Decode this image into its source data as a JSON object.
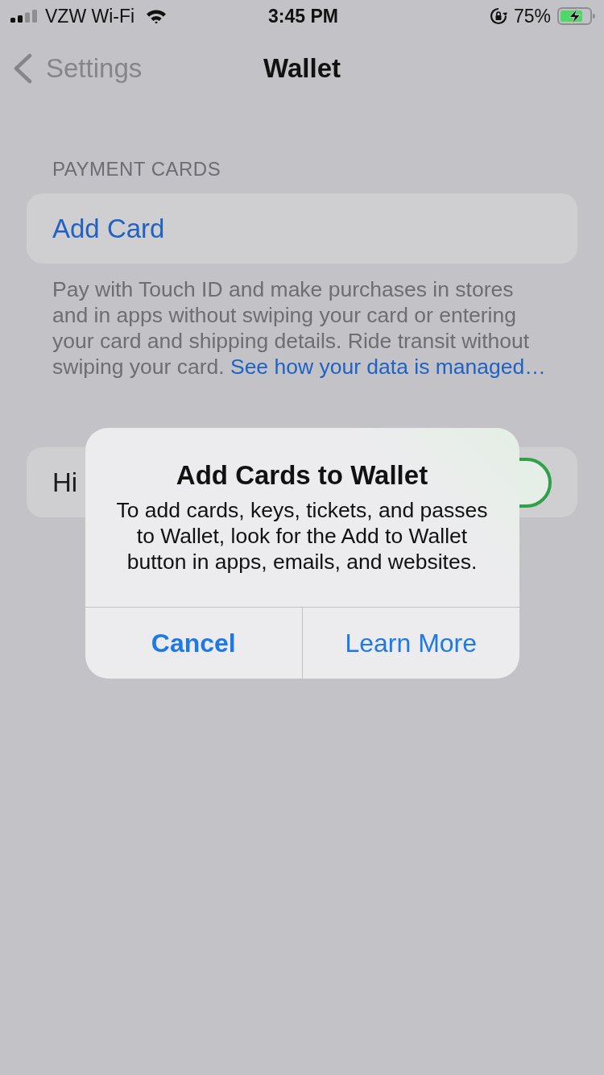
{
  "status_bar": {
    "carrier": "VZW Wi-Fi",
    "time": "3:45 PM",
    "battery": "75%",
    "charging": true
  },
  "nav_bar": {
    "back": "Settings",
    "title": "Wallet"
  },
  "payment_cards": {
    "header": "PAYMENT CARDS",
    "add_card": "Add Card",
    "footer": "Pay with Touch ID and make purchases in stores and in apps without swiping your card or entering your card and shipping details. Ride transit without swiping your card.",
    "footer_link": "See how your data is managed…"
  },
  "setting_row": {
    "label": "Hi",
    "on": true
  },
  "alert": {
    "title": "Add Cards to Wallet",
    "message": "To add cards, keys, tickets, and passes to Wallet, look for the Add to Wallet button in apps, emails, and websites.",
    "buttons": [
      {
        "label": "Cancel",
        "kind": "preferred"
      },
      {
        "label": "Learn More",
        "kind": "default"
      }
    ]
  }
}
